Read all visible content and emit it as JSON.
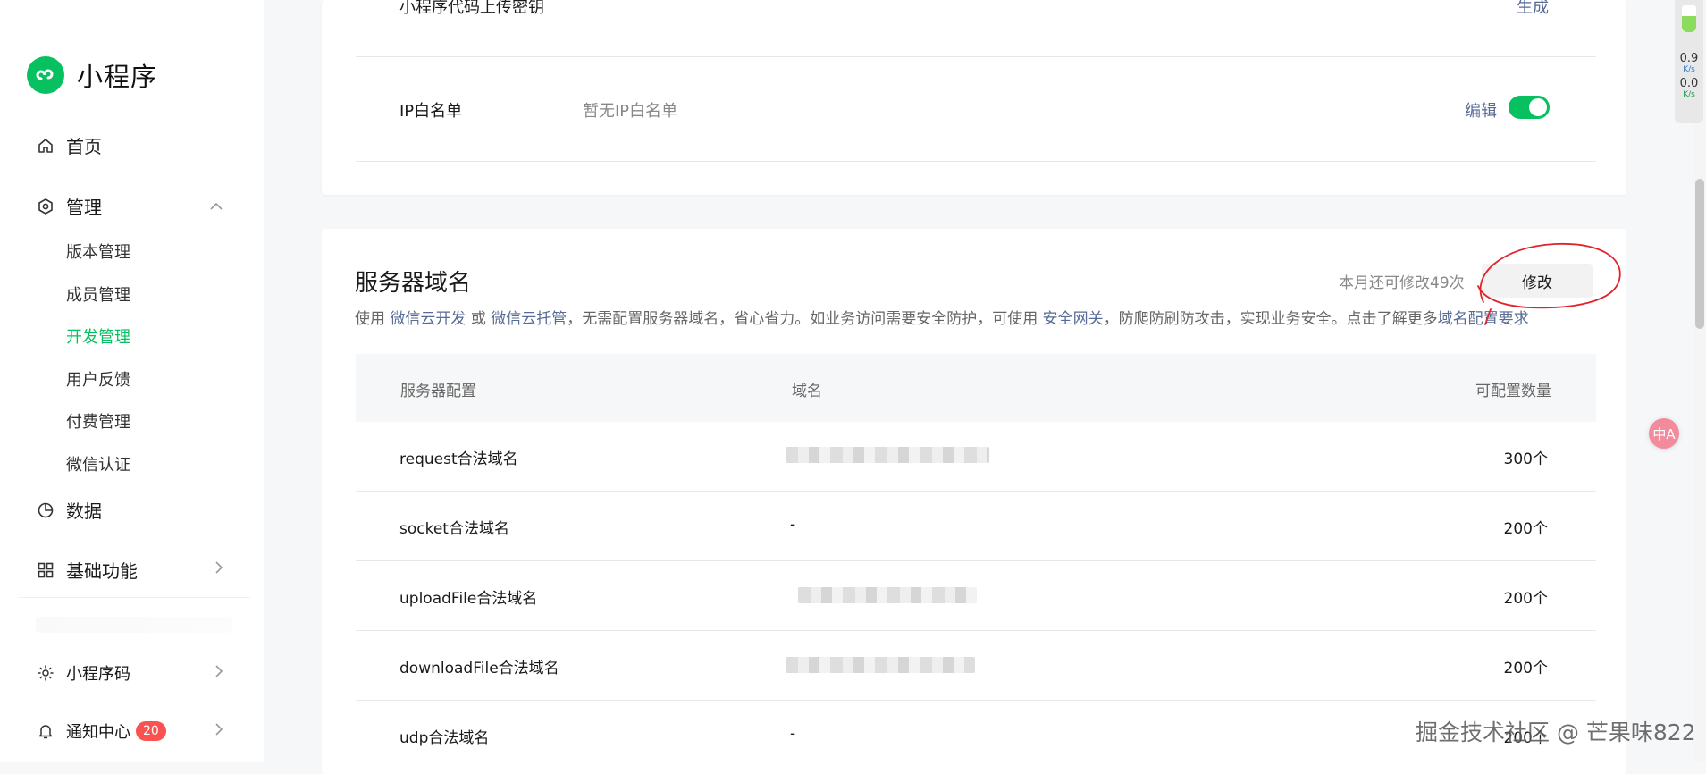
{
  "app": {
    "name": "小程序"
  },
  "sidebar": {
    "home": "首页",
    "manage": {
      "label": "管理",
      "items": [
        "版本管理",
        "成员管理",
        "开发管理",
        "用户反馈",
        "付费管理",
        "微信认证"
      ]
    },
    "data": "数据",
    "basic": "基础功能",
    "qrcode": "小程序码",
    "notify": {
      "label": "通知中心",
      "badge": "20"
    }
  },
  "top_card": {
    "upload_key": {
      "label": "小程序代码上传密钥",
      "action": "生成"
    },
    "ip_whitelist": {
      "label": "IP白名单",
      "value": "暂无IP白名单",
      "edit": "编辑",
      "enabled": true
    }
  },
  "server_domain": {
    "title": "服务器域名",
    "remaining": "本月还可修改49次",
    "modify_button": "修改",
    "desc": {
      "p1": "使用",
      "link1": "微信云开发",
      "p2": "或",
      "link2": "微信云托管",
      "p3": "，无需配置服务器域名，省心省力。如业务访问需要安全防护，可使用",
      "link3": "安全网关",
      "p4": "，防爬防刷防攻击，实现业务安全。点击了解更多",
      "link4": "域名配置要求"
    },
    "table": {
      "headers": [
        "服务器配置",
        "域名",
        "可配置数量"
      ],
      "rows": [
        {
          "name": "request合法域名",
          "domain": "",
          "count": "300个"
        },
        {
          "name": "socket合法域名",
          "domain": "-",
          "count": "200个"
        },
        {
          "name": "uploadFile合法域名",
          "domain": "",
          "count": "200个"
        },
        {
          "name": "downloadFile合法域名",
          "domain": "",
          "count": "200个"
        },
        {
          "name": "udp合法域名",
          "domain": "-",
          "count": "200个"
        }
      ]
    }
  },
  "widgets": {
    "net_up": "0.9",
    "net_down": "0.0",
    "net_unit": "K/s",
    "translate": "中A"
  },
  "watermark": "掘金技术社区 @ 芒果味822",
  "colors": {
    "accent": "#07c160",
    "link": "#576b95",
    "badge": "#fa5151",
    "annotation": "#e0242a"
  }
}
